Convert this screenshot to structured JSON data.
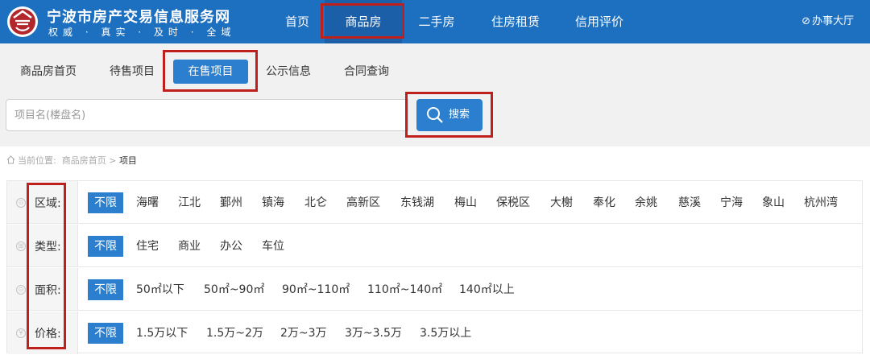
{
  "header": {
    "title": "宁波市房产交易信息服务网",
    "slogan": "权威 · 真实 · 及时 · 全域",
    "nav": [
      "首页",
      "商品房",
      "二手房",
      "住房租赁",
      "信用评价"
    ],
    "active_nav": "商品房",
    "service": "办事大厅",
    "logo_icon": "house-seal-icon",
    "brand_color": "#1d6fc0"
  },
  "tabs": [
    "商品房首页",
    "待售项目",
    "在售项目",
    "公示信息",
    "合同查询"
  ],
  "active_tab": "在售项目",
  "search": {
    "placeholder": "项目名(楼盘名)",
    "button": "搜索"
  },
  "breadcrumb": {
    "prefix": "当前位置:",
    "parent": "商品房首页",
    "sep": ">",
    "current": "项目"
  },
  "filters": [
    {
      "label": "区域:",
      "icon": "district-icon",
      "options": [
        "不限",
        "海曙",
        "江北",
        "鄞州",
        "镇海",
        "北仑",
        "高新区",
        "东钱湖",
        "梅山",
        "保税区",
        "大榭",
        "奉化",
        "余姚",
        "慈溪",
        "宁海",
        "象山",
        "杭州湾"
      ]
    },
    {
      "label": "类型:",
      "icon": "type-icon",
      "options": [
        "不限",
        "住宅",
        "商业",
        "办公",
        "车位"
      ]
    },
    {
      "label": "面积:",
      "icon": "area-icon",
      "options": [
        "不限",
        "50㎡以下",
        "50㎡~90㎡",
        "90㎡~110㎡",
        "110㎡~140㎡",
        "140㎡以上"
      ]
    },
    {
      "label": "价格:",
      "icon": "yen-icon",
      "options": [
        "不限",
        "1.5万以下",
        "1.5万~2万",
        "2万~3万",
        "3万~3.5万",
        "3.5万以上"
      ]
    }
  ],
  "selected_option": "不限",
  "accent_color": "#2c7fce",
  "annotation_color": "#c0201b"
}
